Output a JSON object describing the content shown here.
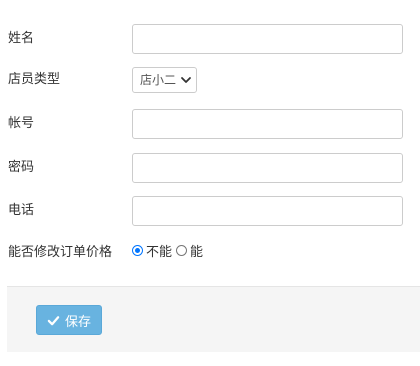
{
  "form": {
    "name": {
      "label": "姓名",
      "value": ""
    },
    "staff_type": {
      "label": "店员类型",
      "selected": "店小二"
    },
    "account": {
      "label": "帐号",
      "value": ""
    },
    "password": {
      "label": "密码",
      "value": ""
    },
    "phone": {
      "label": "电话",
      "value": ""
    },
    "price_permission": {
      "label": "能否修改订单价格",
      "options": [
        {
          "label": "不能",
          "checked": true
        },
        {
          "label": "能",
          "checked": false
        }
      ]
    }
  },
  "footer": {
    "save_label": "保存",
    "save_icon": "check-icon",
    "button_color": "#68b3e0"
  }
}
